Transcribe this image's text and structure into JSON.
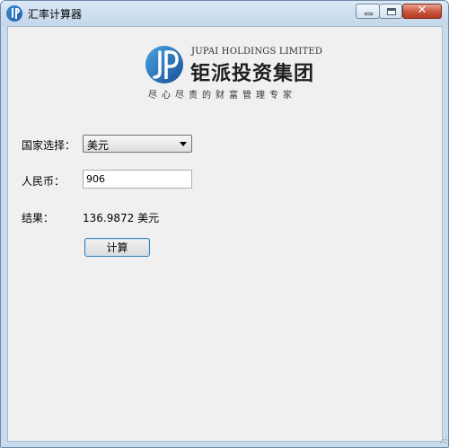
{
  "window": {
    "title": "汇率计算器",
    "controls": {
      "minimize": "minimize",
      "maximize": "maximize",
      "close": "✕"
    }
  },
  "logo": {
    "mark_text": "JP",
    "company_en": "JUPAI HOLDINGS LIMITED",
    "company_cn": "钜派投资集团",
    "slogan": "尽心尽责的财富管理专家"
  },
  "form": {
    "country": {
      "label": "国家选择：",
      "selected": "美元"
    },
    "rmb": {
      "label": "人民币：",
      "value": "906"
    },
    "result": {
      "label": "结果：",
      "value": "136.9872 美元"
    },
    "calculate_label": "计算"
  },
  "colors": {
    "logo_blue": "#1f5fa8",
    "button_border": "#3c7fb1",
    "client_bg": "#f0f0f0"
  }
}
